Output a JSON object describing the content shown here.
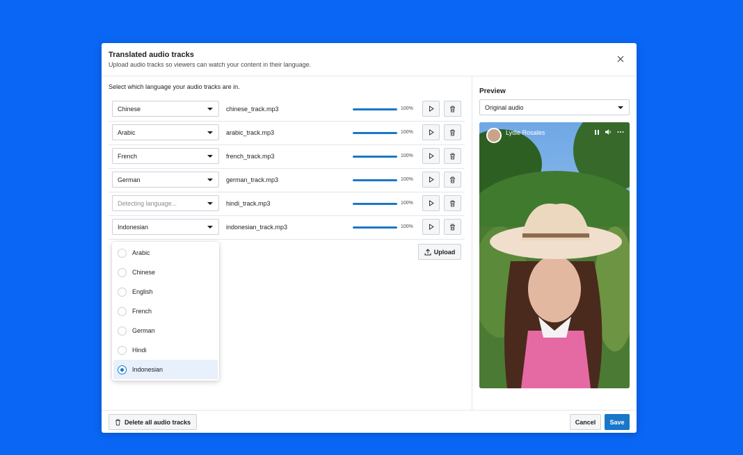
{
  "modal": {
    "title": "Translated audio tracks",
    "subtitle": "Upload audio tracks so viewers can watch your content in their language."
  },
  "left": {
    "instruction": "Select which language your audio tracks are in.",
    "tracks": [
      {
        "language": "Chinese",
        "file": "chinese_track.mp3",
        "progress": 100,
        "progress_label": "100%"
      },
      {
        "language": "Arabic",
        "file": "arabic_track.mp3",
        "progress": 100,
        "progress_label": "100%"
      },
      {
        "language": "French",
        "file": "french_track.mp3",
        "progress": 100,
        "progress_label": "100%"
      },
      {
        "language": "German",
        "file": "german_track.mp3",
        "progress": 100,
        "progress_label": "100%"
      },
      {
        "language": "Detecting language...",
        "file": "hindi_track.mp3",
        "progress": 100,
        "progress_label": "100%"
      },
      {
        "language": "Indonesian",
        "file": "indonesian_track.mp3",
        "progress": 100,
        "progress_label": "100%"
      }
    ],
    "upload_label": "Upload",
    "dropdown_options": [
      {
        "label": "Arabic",
        "selected": false
      },
      {
        "label": "Chinese",
        "selected": false
      },
      {
        "label": "English",
        "selected": false
      },
      {
        "label": "French",
        "selected": false
      },
      {
        "label": "German",
        "selected": false
      },
      {
        "label": "Hindi",
        "selected": false
      },
      {
        "label": "Indonesian",
        "selected": true
      }
    ]
  },
  "preview": {
    "title": "Preview",
    "audio_select": "Original audio",
    "video_author": "Lydie Rosales"
  },
  "footer": {
    "delete_all_label": "Delete all audio tracks",
    "cancel_label": "Cancel",
    "save_label": "Save"
  },
  "colors": {
    "background": "#0a66f5",
    "accent": "#1877c9"
  },
  "icons": {
    "close": "close-icon",
    "caret": "chevron-down-icon",
    "play": "play-icon",
    "trash": "trash-icon",
    "upload": "upload-icon",
    "pause": "pause-icon",
    "volume": "volume-icon",
    "more": "more-icon"
  }
}
